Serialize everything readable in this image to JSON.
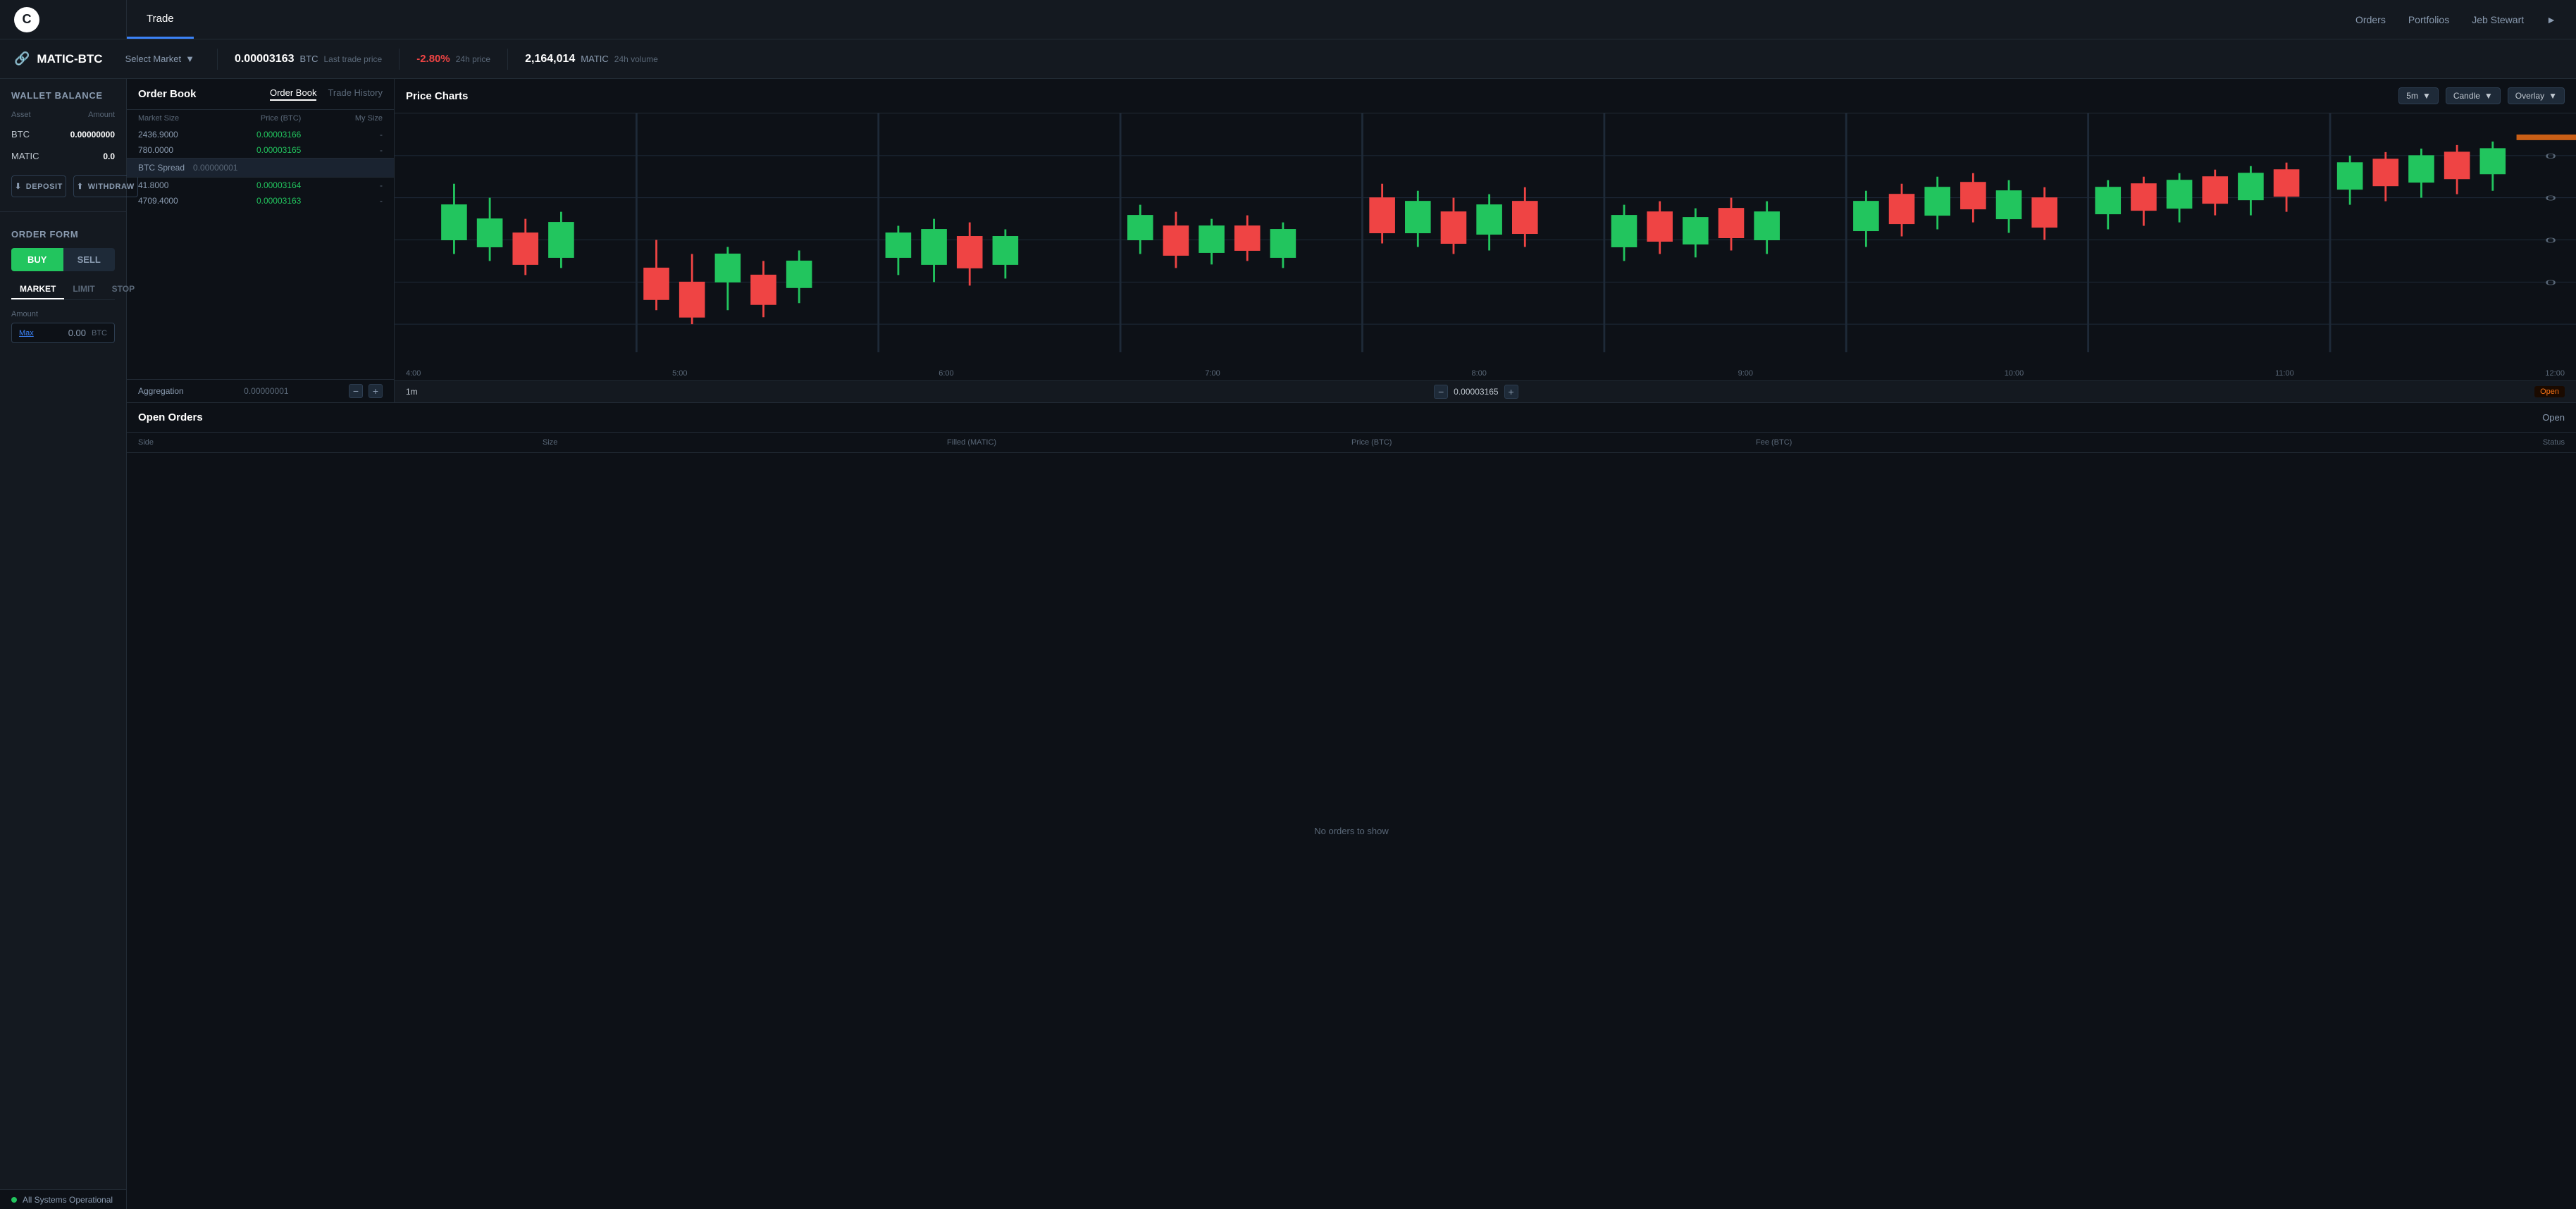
{
  "app": {
    "logo": "C",
    "nav": {
      "tabs": [
        {
          "label": "Trade",
          "active": true
        },
        {
          "label": "Orders",
          "active": false
        },
        {
          "label": "Portfolios",
          "active": false
        }
      ],
      "user": "Jeb Stewart"
    }
  },
  "market": {
    "pair": "MATIC-BTC",
    "select_market_label": "Select Market",
    "last_trade_price": "0.00003163",
    "last_trade_currency": "BTC",
    "last_trade_label": "Last trade price",
    "price_change": "-2.80%",
    "price_change_label": "24h price",
    "volume": "2,164,014",
    "volume_currency": "MATIC",
    "volume_label": "24h volume"
  },
  "wallet": {
    "section_title": "Wallet Balance",
    "col_asset": "Asset",
    "col_amount": "Amount",
    "rows": [
      {
        "asset": "BTC",
        "amount": "0.00000000"
      },
      {
        "asset": "MATIC",
        "amount": "0.0"
      }
    ],
    "deposit_label": "DEPOSIT",
    "withdraw_label": "WITHDRAW"
  },
  "order_form": {
    "section_title": "Order Form",
    "buy_label": "BUY",
    "sell_label": "SELL",
    "types": [
      {
        "label": "MARKET",
        "active": true
      },
      {
        "label": "LIMIT",
        "active": false
      },
      {
        "label": "STOP",
        "active": false
      }
    ],
    "amount_label": "Amount",
    "amount_max": "Max",
    "amount_value": "0.00",
    "amount_currency": "BTC"
  },
  "order_book": {
    "panel_title": "Order Book",
    "sub_tabs": [
      {
        "label": "Order Book",
        "active": true
      },
      {
        "label": "Trade History",
        "active": false
      }
    ],
    "col_market_size": "Market Size",
    "col_price": "Price (BTC)",
    "col_my_size": "My Size",
    "asks": [
      {
        "size": "2436.9000",
        "price": "0.00003166",
        "my_size": "-"
      },
      {
        "size": "780.0000",
        "price": "0.00003165",
        "my_size": "-"
      }
    ],
    "spread_label": "BTC Spread",
    "spread_value": "0.00000001",
    "bids": [
      {
        "size": "41.8000",
        "price": "0.00003164",
        "my_size": "-"
      },
      {
        "size": "4709.4000",
        "price": "0.00003163",
        "my_size": "-"
      }
    ],
    "aggregation_label": "Aggregation",
    "aggregation_value": "0.00000001"
  },
  "chart": {
    "panel_title": "Price Charts",
    "timeframe": "5m",
    "chart_type": "Candle",
    "overlay": "Overlay",
    "x_labels": [
      "4:00",
      "5:00",
      "6:00",
      "7:00",
      "8:00",
      "9:00",
      "10:00",
      "11:00",
      "12:00"
    ],
    "aggregation_label": "1m",
    "aggregation_value": "0.00003165",
    "open_label": "Open"
  },
  "open_orders": {
    "panel_title": "Open Orders",
    "open_label": "Open",
    "col_side": "Side",
    "col_size": "Size",
    "col_filled": "Filled (MATIC)",
    "col_price": "Price (BTC)",
    "col_fee": "Fee (BTC)",
    "col_status": "Status",
    "empty_message": "No orders to show"
  },
  "status": {
    "text": "All Systems Operational",
    "dot_color": "#22c55e"
  }
}
